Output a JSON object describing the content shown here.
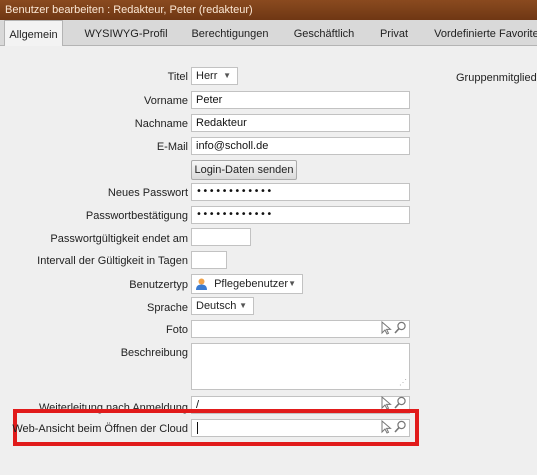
{
  "window": {
    "title": "Benutzer bearbeiten : Redakteur, Peter (redakteur)"
  },
  "tabs": [
    {
      "label": "Allgemein",
      "active": true
    },
    {
      "label": "WYSIWYG-Profil"
    },
    {
      "label": "Berechtigungen"
    },
    {
      "label": "Geschäftlich"
    },
    {
      "label": "Privat"
    },
    {
      "label": "Vordefinierte Favoriten"
    }
  ],
  "form": {
    "title": {
      "label": "Titel",
      "value": "Herr"
    },
    "firstname": {
      "label": "Vorname",
      "value": "Peter"
    },
    "lastname": {
      "label": "Nachname",
      "value": "Redakteur"
    },
    "email": {
      "label": "E-Mail",
      "value": "info@scholl.de"
    },
    "send_login_button": "Login-Daten senden",
    "new_password": {
      "label": "Neues Passwort",
      "value": "••••••••••••"
    },
    "password_confirm": {
      "label": "Passwortbestätigung",
      "value": "••••••••••••"
    },
    "password_expiry": {
      "label": "Passwortgültigkeit endet am",
      "value": ""
    },
    "validity_interval": {
      "label": "Intervall der Gültigkeit in Tagen",
      "value": ""
    },
    "usertype": {
      "label": "Benutzertyp",
      "value": "Pflegebenutzer"
    },
    "language": {
      "label": "Sprache",
      "value": "Deutsch"
    },
    "photo": {
      "label": "Foto",
      "value": ""
    },
    "description": {
      "label": "Beschreibung",
      "value": ""
    },
    "redirect": {
      "label": "Weiterleitung nach Anmeldung",
      "value": "/"
    },
    "web_view": {
      "label": "Web-Ansicht beim Öffnen der Cloud",
      "value": ""
    }
  },
  "group_membership_label": "Gruppenmitgliedsc",
  "colors": {
    "titlebar": "#7a4118",
    "highlight": "#e11b1b"
  }
}
